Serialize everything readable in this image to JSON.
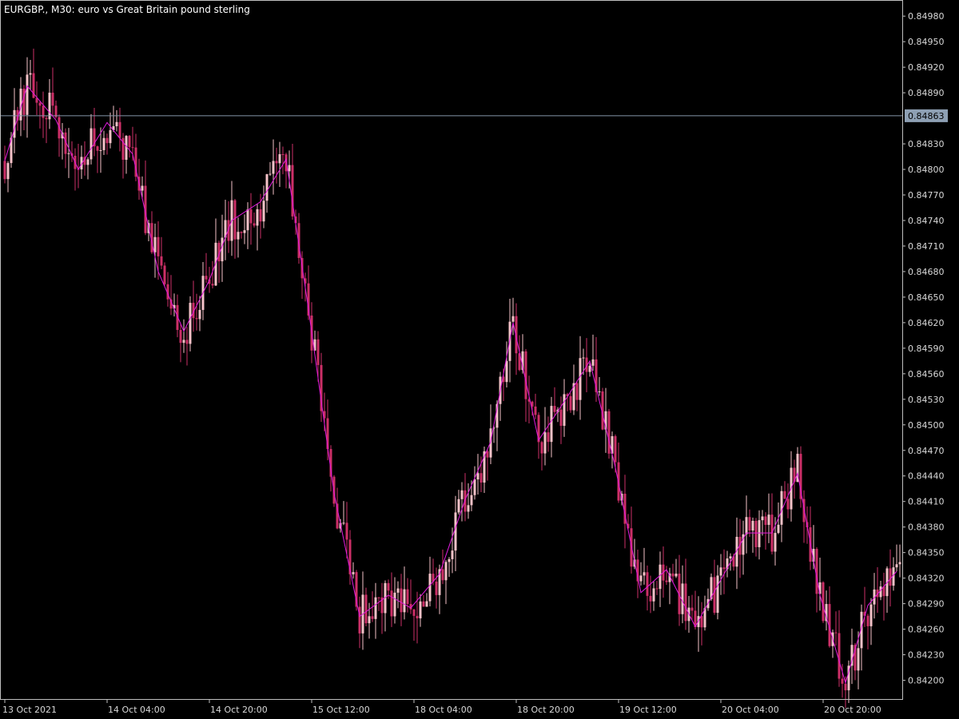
{
  "window": {
    "symbol_title": "EURGBP., M30:  euro vs Great Britain pound sterling",
    "current_price_label": "0.84863"
  },
  "colors": {
    "background": "#000000",
    "frame": "#bfbfbf",
    "grid_text": "#d8d8d8",
    "bull": "#f4c2c8",
    "bear": "#cc2f67",
    "zigzag": "#e21adf",
    "tick_green": "#22c32a",
    "price_line": "#8595a8",
    "price_tag_bg": "#8ea0b4"
  },
  "chart_data": {
    "type": "candlestick",
    "title": "EURGBP., M30:  euro vs Great Britain pound sterling",
    "xlabel": "",
    "ylabel": "",
    "ylim": [
      0.84178,
      0.84998
    ],
    "y_ticks": [
      "0.84980",
      "0.84950",
      "0.84920",
      "0.84890",
      "0.84863",
      "0.84830",
      "0.84800",
      "0.84770",
      "0.84740",
      "0.84710",
      "0.84680",
      "0.84650",
      "0.84620",
      "0.84590",
      "0.84560",
      "0.84530",
      "0.84500",
      "0.84470",
      "0.84440",
      "0.84410",
      "0.84380",
      "0.84350",
      "0.84320",
      "0.84290",
      "0.84260",
      "0.84230",
      "0.84200"
    ],
    "x_ticks": [
      "13 Oct 2021",
      "14 Oct 04:00",
      "14 Oct 20:00",
      "15 Oct 12:00",
      "18 Oct 04:00",
      "18 Oct 20:00",
      "19 Oct 12:00",
      "20 Oct 04:00",
      "20 Oct 20:00"
    ],
    "x_tick_bar_index": [
      0,
      32,
      64,
      96,
      128,
      160,
      192,
      224,
      256
    ],
    "current_price": 0.84863,
    "zigzag": [
      {
        "bar": 0,
        "price": 0.8481
      },
      {
        "bar": 7,
        "price": 0.84898
      },
      {
        "bar": 16,
        "price": 0.84858
      },
      {
        "bar": 23,
        "price": 0.848
      },
      {
        "bar": 32,
        "price": 0.84855
      },
      {
        "bar": 40,
        "price": 0.84818
      },
      {
        "bar": 48,
        "price": 0.8468
      },
      {
        "bar": 56,
        "price": 0.8461
      },
      {
        "bar": 64,
        "price": 0.8467
      },
      {
        "bar": 71,
        "price": 0.8474
      },
      {
        "bar": 80,
        "price": 0.84762
      },
      {
        "bar": 88,
        "price": 0.84812
      },
      {
        "bar": 95,
        "price": 0.84636
      },
      {
        "bar": 103,
        "price": 0.8442
      },
      {
        "bar": 111,
        "price": 0.84275
      },
      {
        "bar": 120,
        "price": 0.843
      },
      {
        "bar": 127,
        "price": 0.84285
      },
      {
        "bar": 136,
        "price": 0.84325
      },
      {
        "bar": 144,
        "price": 0.84412
      },
      {
        "bar": 152,
        "price": 0.8448
      },
      {
        "bar": 159,
        "price": 0.8462
      },
      {
        "bar": 167,
        "price": 0.84482
      },
      {
        "bar": 176,
        "price": 0.84533
      },
      {
        "bar": 183,
        "price": 0.84575
      },
      {
        "bar": 191,
        "price": 0.8445
      },
      {
        "bar": 199,
        "price": 0.84303
      },
      {
        "bar": 207,
        "price": 0.8433
      },
      {
        "bar": 216,
        "price": 0.84263
      },
      {
        "bar": 224,
        "price": 0.84318
      },
      {
        "bar": 232,
        "price": 0.84373
      },
      {
        "bar": 240,
        "price": 0.84373
      },
      {
        "bar": 248,
        "price": 0.84443
      },
      {
        "bar": 255,
        "price": 0.843
      },
      {
        "bar": 263,
        "price": 0.84197
      },
      {
        "bar": 270,
        "price": 0.84288
      },
      {
        "bar": 279,
        "price": 0.84328
      }
    ]
  }
}
